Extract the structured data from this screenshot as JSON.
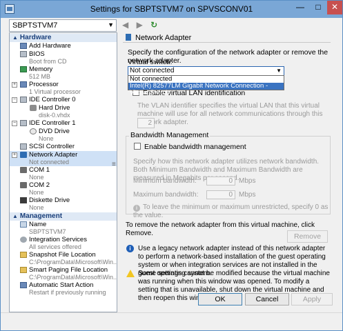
{
  "window": {
    "title": "Settings for SBPTSTVM7 on SPVSCONV01",
    "min": "—",
    "max": "□",
    "close": "✕"
  },
  "vm_selector": {
    "value": "SBPTSTVM7"
  },
  "nav": {
    "back": "◀",
    "forward": "▶",
    "refresh": "↻"
  },
  "tree": {
    "hardware_label": "Hardware",
    "management_label": "Management",
    "hardware": [
      {
        "label": "Add Hardware",
        "sub": ""
      },
      {
        "label": "BIOS",
        "sub": "Boot from CD"
      },
      {
        "label": "Memory",
        "sub": "512 MB"
      },
      {
        "label": "Processor",
        "sub": "1 Virtual processor"
      },
      {
        "label": "IDE Controller 0",
        "sub": ""
      },
      {
        "label": "Hard Drive",
        "sub": "disk-0.vhdx"
      },
      {
        "label": "IDE Controller 1",
        "sub": ""
      },
      {
        "label": "DVD Drive",
        "sub": "None"
      },
      {
        "label": "SCSI Controller",
        "sub": ""
      },
      {
        "label": "Network Adapter",
        "sub": "Not connected"
      },
      {
        "label": "COM 1",
        "sub": "None"
      },
      {
        "label": "COM 2",
        "sub": "None"
      },
      {
        "label": "Diskette Drive",
        "sub": "None"
      }
    ],
    "management": [
      {
        "label": "Name",
        "sub": "SBPTSTVM7"
      },
      {
        "label": "Integration Services",
        "sub": "All services offered"
      },
      {
        "label": "Snapshot File Location",
        "sub": "C:\\ProgramData\\Microsoft\\Win..."
      },
      {
        "label": "Smart Paging File Location",
        "sub": "C:\\ProgramData\\Microsoft\\Win..."
      },
      {
        "label": "Automatic Start Action",
        "sub": "Restart if previously running"
      }
    ]
  },
  "panel": {
    "section_title": "Network Adapter",
    "description": "Specify the configuration of the network adapter or remove the network adapter.",
    "virtual_switch_label": "Virtual switch:",
    "virtual_switch_value": "Not connected",
    "virtual_switch_options": [
      "Not connected",
      "Intel(R) 82577LM Gigabit Network Connection - Virtual Switch"
    ],
    "vlan_checkbox_label": "Enable virtual LAN identification",
    "vlan_desc": "The VLAN identifier specifies the virtual LAN that this virtual machine will use for all network communications through this network adapter.",
    "vlan_value": "2",
    "bandwidth_title": "Bandwidth Management",
    "bandwidth_checkbox_label": "Enable bandwidth management",
    "bandwidth_desc": "Specify how this network adapter utilizes network bandwidth. Both Minimum Bandwidth and Maximum Bandwidth are measured in Megabits per second.",
    "min_label": "Minimum bandwidth:",
    "min_value": "0",
    "max_label": "Maximum bandwidth:",
    "max_value": "0",
    "unit": "Mbps",
    "bandwidth_note": "To leave the minimum or maximum unrestricted, specify 0 as the value.",
    "remove_text": "To remove the network adapter from this virtual machine, click Remove.",
    "remove_button": "Remove",
    "legacy_note": "Use a legacy network adapter instead of this network adapter to perform a network-based installation of the guest operating system or when integration services are not installed in the guest operating system.",
    "warning_note": "Some settings cannot be modified because the virtual machine was running when this window was opened. To modify a setting that is unavailable, shut down the virtual machine and then reopen this window."
  },
  "buttons": {
    "ok": "OK",
    "cancel": "Cancel",
    "apply": "Apply"
  }
}
